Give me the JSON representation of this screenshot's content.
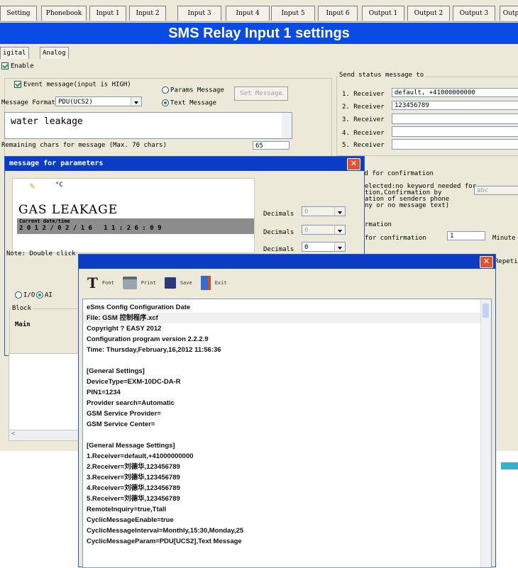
{
  "tabs": [
    "Setting",
    "Phonebook",
    "Input 1",
    "Input 2",
    "Input 3",
    "Input 4",
    "Input 5",
    "Input 6",
    "Output 1",
    "Output 2",
    "Output 3",
    "Outp"
  ],
  "title": "SMS Relay Input 1 settings",
  "subtabs": [
    "igital",
    "Analog"
  ],
  "enable_label": "Enable",
  "event_label": "Event message(input is HIGH)",
  "message_format_label": "Message Format",
  "message_format_value": "PDU(UCS2)",
  "params_message_label": "Params Message",
  "text_message_label": "Text Message",
  "set_message_button": "Set Message",
  "message_text": "water leakage",
  "remaining_label": "Remaining chars for message (Max. 70 chars)",
  "remaining_value": "65",
  "send_status_label": "Send status message to",
  "receivers": [
    {
      "label": "1. Receiver",
      "value": "default, +41000000000"
    },
    {
      "label": "2. Receiver",
      "value": "123456789"
    },
    {
      "label": "3. Receiver",
      "value": ""
    },
    {
      "label": "4. Receiver",
      "value": ""
    },
    {
      "label": "5. Receiver",
      "value": ""
    }
  ],
  "confirm_text": {
    "line1": "rd for confirmation",
    "line2": "elected:no keyword needed for",
    "line3": "tion,Confirmation by",
    "line4": "ation of senders phone",
    "line5": "ny or no message text)",
    "keyword_value": "abc",
    "line6": "rmation",
    "line7": "for confirmation",
    "confirm_value": "1",
    "unit": "Minute",
    "repeat": "Repetit"
  },
  "dialog1": {
    "title": "message for parameters",
    "icon_label": "°C",
    "gas_text": "GAS  LEAKAGE",
    "current_label": "Current date/time",
    "date_digits": "2 0 1 2 / 0 2 / 1 6   1 1 : 2 6 : 0 9",
    "decimals": [
      {
        "label": "Decimals",
        "value": "0"
      },
      {
        "label": "Decimals",
        "value": "0"
      },
      {
        "label": "Decimals",
        "value": "0"
      }
    ],
    "note": "Note: Double click",
    "radio_io": "I/O",
    "radio_ai": "AI",
    "block_label": "Block",
    "block_item": "Main"
  },
  "dialog2": {
    "toolbar": [
      {
        "icon": "font-icon",
        "label": "Font"
      },
      {
        "icon": "print-icon",
        "label": "Print"
      },
      {
        "icon": "save-icon",
        "label": "Save"
      },
      {
        "icon": "exit-icon",
        "label": "Exit"
      }
    ],
    "lines": [
      "eSms Config Configuration Date",
      "File: GSM 控制程序.xcf",
      "Copyright ? EASY 2012",
      "Configuration program version 2.2.2.9",
      "Time: Thursday,February,16,2012 11:56:36",
      "",
      "[General Settings]",
      "DeviceType=EXM-10DC-DA-R",
      "PIN1=1234",
      "Provider search=Automatic",
      "GSM Service Provider=",
      "GSM Service Center=",
      "",
      "[General Message Settings]",
      "1.Receiver=default,+41000000000",
      "2.Receiver=刘德华,123456789",
      "3.Receiver=刘德华,123456789",
      "4.Receiver=刘德华,123456789",
      "5.Receiver=刘德华,123456789",
      "RemoteInquiry=true,Ttall",
      "CyclicMessageEnable=true",
      "CyclicMessageInterval=Monthly,15:30,Monday,25",
      "CyclicMessageParam=PDU[UCS2],Text Message"
    ]
  }
}
